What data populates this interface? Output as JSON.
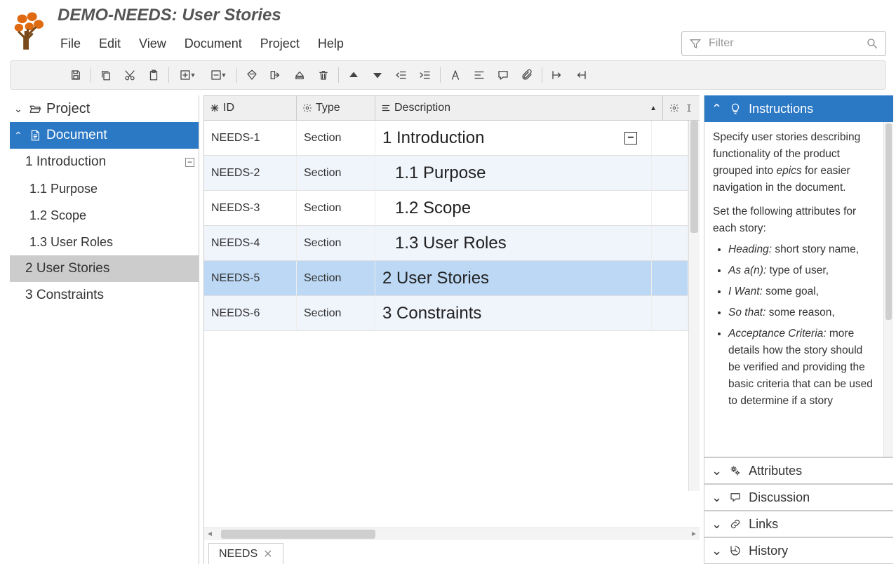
{
  "app": {
    "title": "DEMO-NEEDS: User Stories",
    "menus": [
      "File",
      "Edit",
      "View",
      "Document",
      "Project",
      "Help"
    ],
    "filter_placeholder": "Filter"
  },
  "toolbar": {
    "buttons": [
      {
        "name": "save-icon"
      },
      {
        "sep": true
      },
      {
        "name": "copy-icon"
      },
      {
        "name": "cut-icon"
      },
      {
        "name": "paste-icon"
      },
      {
        "sep": true
      },
      {
        "name": "add-icon",
        "dropdown": true
      },
      {
        "name": "remove-icon",
        "dropdown": true
      },
      {
        "sep": true
      },
      {
        "name": "tag-icon"
      },
      {
        "name": "merge-right-icon"
      },
      {
        "name": "eject-icon"
      },
      {
        "name": "delete-icon"
      },
      {
        "sep": true
      },
      {
        "name": "move-up-icon"
      },
      {
        "name": "move-down-icon"
      },
      {
        "name": "outdent-icon"
      },
      {
        "name": "indent-icon"
      },
      {
        "sep": true
      },
      {
        "name": "font-icon"
      },
      {
        "name": "align-icon"
      },
      {
        "name": "comment-icon"
      },
      {
        "name": "attachment-icon"
      },
      {
        "sep": true
      },
      {
        "name": "expand-width-icon"
      },
      {
        "name": "collapse-width-icon"
      }
    ]
  },
  "sidebar": {
    "project_label": "Project",
    "document_label": "Document",
    "tree": [
      {
        "label": "1 Introduction",
        "level": 1,
        "collapsible": true
      },
      {
        "label": "1.1 Purpose",
        "level": 2
      },
      {
        "label": "1.2 Scope",
        "level": 2
      },
      {
        "label": "1.3 User Roles",
        "level": 2
      },
      {
        "label": "2 User Stories",
        "level": 1,
        "selected": true
      },
      {
        "label": "3 Constraints",
        "level": 1
      }
    ]
  },
  "grid": {
    "columns": {
      "id": "ID",
      "type": "Type",
      "description": "Description"
    },
    "rows": [
      {
        "id": "NEEDS-1",
        "type": "Section",
        "desc": "1 Introduction",
        "indent": 0,
        "collapsible": true,
        "alt": false
      },
      {
        "id": "NEEDS-2",
        "type": "Section",
        "desc": "1.1 Purpose",
        "indent": 1,
        "alt": true
      },
      {
        "id": "NEEDS-3",
        "type": "Section",
        "desc": "1.2 Scope",
        "indent": 1,
        "alt": false
      },
      {
        "id": "NEEDS-4",
        "type": "Section",
        "desc": "1.3 User Roles",
        "indent": 1,
        "alt": true
      },
      {
        "id": "NEEDS-5",
        "type": "Section",
        "desc": "2 User Stories",
        "indent": 0,
        "selected": true
      },
      {
        "id": "NEEDS-6",
        "type": "Section",
        "desc": "3 Constraints",
        "indent": 0,
        "alt": true
      }
    ],
    "tab_label": "NEEDS"
  },
  "right": {
    "instructions": {
      "title": "Instructions",
      "para1_a": "Specify user stories describing functionality of the product grouped into ",
      "para1_em": "epics",
      "para1_b": " for easier navigation in the document.",
      "para2": "Set the following attributes for each story:",
      "items": [
        {
          "em": "Heading:",
          "txt": " short story name,"
        },
        {
          "em": "As a(n):",
          "txt": " type of user,"
        },
        {
          "em": "I Want:",
          "txt": " some goal,"
        },
        {
          "em": "So that:",
          "txt": " some reason,"
        },
        {
          "em": "Acceptance Criteria:",
          "txt": " more details how the story should be verified and providing the basic criteria that can be used to determine if a story"
        }
      ]
    },
    "sections": [
      {
        "name": "attributes",
        "label": "Attributes",
        "icon": "gears-icon"
      },
      {
        "name": "discussion",
        "label": "Discussion",
        "icon": "chat-icon"
      },
      {
        "name": "links",
        "label": "Links",
        "icon": "link-icon"
      },
      {
        "name": "history",
        "label": "History",
        "icon": "history-icon"
      }
    ]
  }
}
